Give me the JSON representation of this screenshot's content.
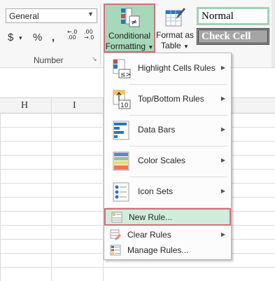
{
  "number_group": {
    "format_value": "General",
    "currency_symbol": "$",
    "percent_symbol": "%",
    "comma_symbol": ",",
    "increase_decimal_top": "←.0",
    "increase_decimal_bottom": ".00",
    "decrease_decimal_top": ".00",
    "decrease_decimal_bottom": "→.0",
    "group_label": "Number"
  },
  "conditional_formatting": {
    "label_line1": "Conditional",
    "label_line2": "Formatting",
    "accent_color": "#a7d8b9",
    "highlight_border_color": "#d26f7c"
  },
  "format_as_table": {
    "label_line1": "Format as",
    "label_line2": "Table"
  },
  "cell_styles": {
    "normal": "Normal",
    "check_cell": "Check Cell"
  },
  "columns": [
    "H",
    "I"
  ],
  "menu": {
    "items": [
      {
        "label": "Highlight Cells Rules",
        "icon": "highlight-cells-icon",
        "has_submenu": true
      },
      {
        "label": "Top/Bottom Rules",
        "icon": "top-bottom-icon",
        "has_submenu": true
      },
      {
        "label": "Data Bars",
        "icon": "data-bars-icon",
        "has_submenu": true
      },
      {
        "label": "Color Scales",
        "icon": "color-scales-icon",
        "has_submenu": true
      },
      {
        "label": "Icon Sets",
        "icon": "icon-sets-icon",
        "has_submenu": true
      }
    ],
    "small_items": [
      {
        "label": "New Rule...",
        "icon": "new-rule-icon",
        "has_submenu": false,
        "selected": true
      },
      {
        "label": "Clear Rules",
        "icon": "clear-rules-icon",
        "has_submenu": true
      },
      {
        "label": "Manage Rules...",
        "icon": "manage-rules-icon",
        "has_submenu": false
      }
    ]
  }
}
